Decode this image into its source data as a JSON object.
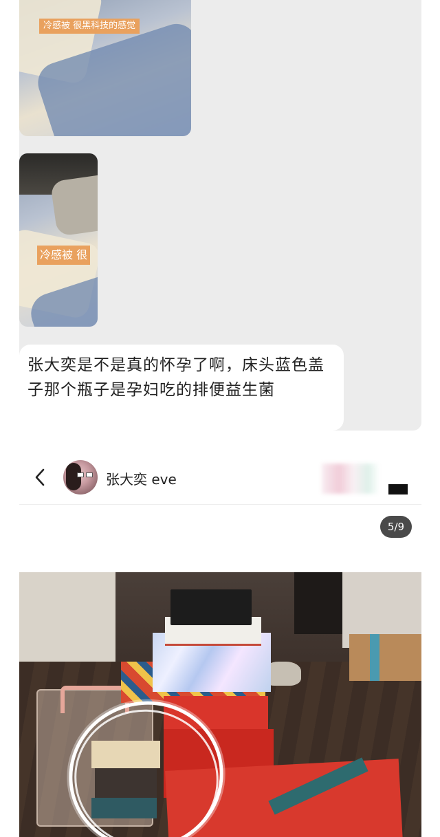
{
  "chat": {
    "photo_1_caption": "冷感被 很黑科技的感觉",
    "photo_2_caption": "冷感被 很",
    "message": "张大奕是不是真的怀孕了啊，床头蓝色盖子那个瓶子是孕妇吃的排便益生菌"
  },
  "post_header": {
    "back_icon": "chevron-left-icon",
    "username": "张大奕 eve"
  },
  "gallery": {
    "page_indicator": "5/9"
  },
  "colors": {
    "caption_bg": "#e9a15e",
    "chat_bg": "#ececec",
    "badge_bg": "#4a4a4a"
  }
}
